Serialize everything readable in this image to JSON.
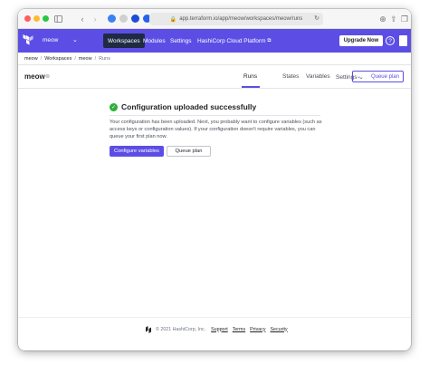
{
  "browser": {
    "url": "app.terraform.io/app/meow/workspaces/meow/runs"
  },
  "navbar": {
    "org_name": "meow",
    "items": [
      "Workspaces",
      "Modules",
      "Settings",
      "HashiCorp Cloud Platform"
    ],
    "external_glyph": "⧉",
    "upgrade_label": "Upgrade Now",
    "help_label": "?"
  },
  "breadcrumb": {
    "items": [
      "meow",
      "Workspaces",
      "meow",
      "Runs"
    ]
  },
  "workspace": {
    "title": "meow",
    "tabs": [
      "Runs",
      "States",
      "Variables",
      "Settings"
    ],
    "queue_label": "Queue plan"
  },
  "message": {
    "title": "Configuration uploaded successfully",
    "body": "Your configuration has been uploaded. Next, you probably want to configure variables (such as access keys or configuration values). If your configuration doesn't require variables, you can queue your first plan now.",
    "primary_label": "Configure variables",
    "secondary_label": "Queue plan"
  },
  "footer": {
    "copyright": "© 2021 HashiCorp, Inc.",
    "links": [
      "Support",
      "Terms",
      "Privacy",
      "Security"
    ]
  },
  "colors": {
    "brand": "#5c4ee5",
    "nav_active": "#1f2a44",
    "success": "#2eb039"
  }
}
